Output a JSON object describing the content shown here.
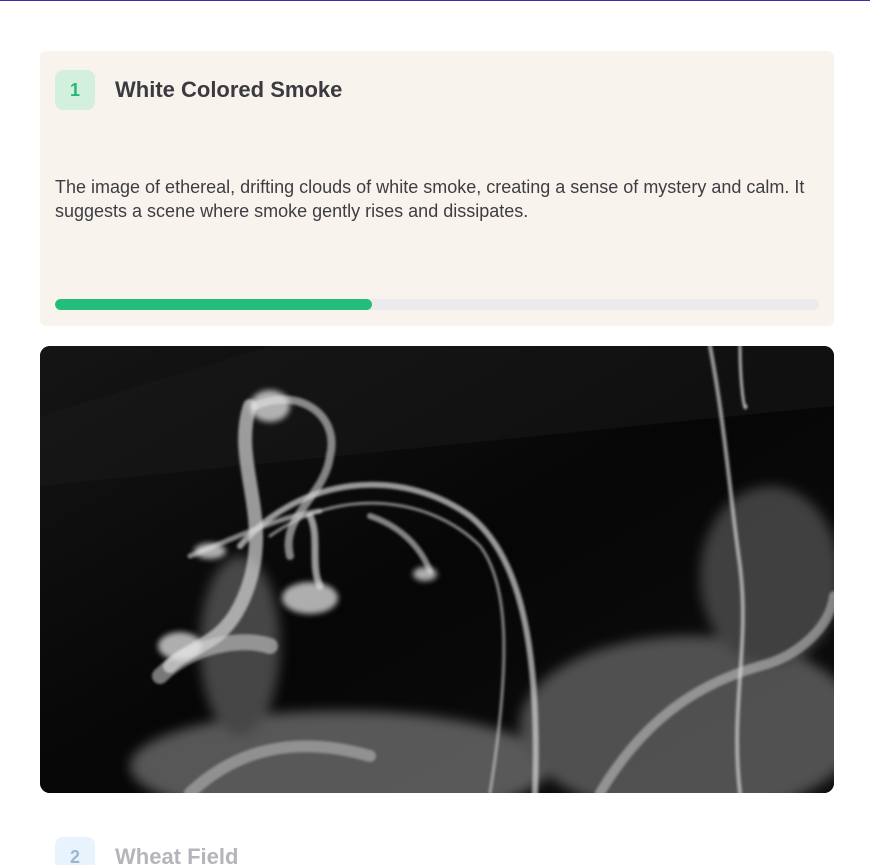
{
  "steps": [
    {
      "number": "1",
      "title": "White Colored Smoke",
      "description": "The image of ethereal, drifting clouds of white smoke, creating a sense of mystery and calm. It suggests a scene where smoke gently rises and dissipates.",
      "progress_percent": 41.5,
      "image_alt": "White colored smoke on black background"
    },
    {
      "number": "2",
      "title": "Wheat Field"
    }
  ],
  "colors": {
    "accent_green": "#23bf7a",
    "card_background": "#f8f3ec",
    "progress_track": "#ebebee",
    "badge_active_bg": "#d3efde",
    "badge_inactive_bg": "#e9f3fd",
    "top_rule": "#3b2ea8"
  }
}
